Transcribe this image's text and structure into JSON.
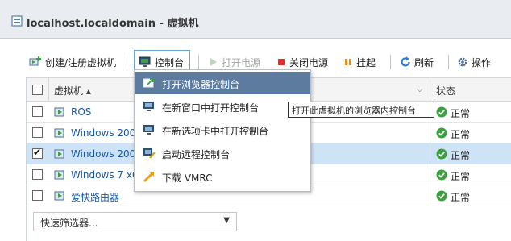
{
  "window": {
    "title": "localhost.localdomain - 虚拟机"
  },
  "toolbar": {
    "create_label": "创建/注册虚拟机",
    "console_label": "控制台",
    "power_on_label": "打开电源",
    "power_off_label": "关闭电源",
    "suspend_label": "挂起",
    "refresh_label": "刷新",
    "actions_label": "操作"
  },
  "grid": {
    "columns": {
      "vm": "虚拟机 ▴",
      "status": "状态"
    },
    "rows": [
      {
        "name": "ROS",
        "status": "正常",
        "selected": false
      },
      {
        "name": "Windows 2008",
        "status": "正常",
        "selected": false
      },
      {
        "name": "Windows 2008",
        "status": "正常",
        "selected": true
      },
      {
        "name": "Windows 7 x64",
        "status": "正常",
        "selected": false
      },
      {
        "name": "爱快路由器",
        "status": "正常",
        "selected": false
      }
    ],
    "filter_label": "快速筛选器..."
  },
  "console_menu": {
    "items": [
      {
        "label": "打开浏览器控制台",
        "icon": "browser-console-icon"
      },
      {
        "label": "在新窗口中打开控制台",
        "icon": "new-window-console-icon"
      },
      {
        "label": "在新选项卡中打开控制台",
        "icon": "new-tab-console-icon"
      },
      {
        "label": "启动远程控制台",
        "icon": "remote-console-icon"
      },
      {
        "label": "下载 VMRC",
        "icon": "download-vmrc-icon"
      }
    ]
  },
  "tooltip": {
    "text": "打开此虚拟机的浏览器内控制台"
  },
  "colors": {
    "accent": "#5c7b9f",
    "selected_row": "#cfe3f7",
    "ok_green": "#3aa040",
    "link": "#1a5aa6"
  }
}
